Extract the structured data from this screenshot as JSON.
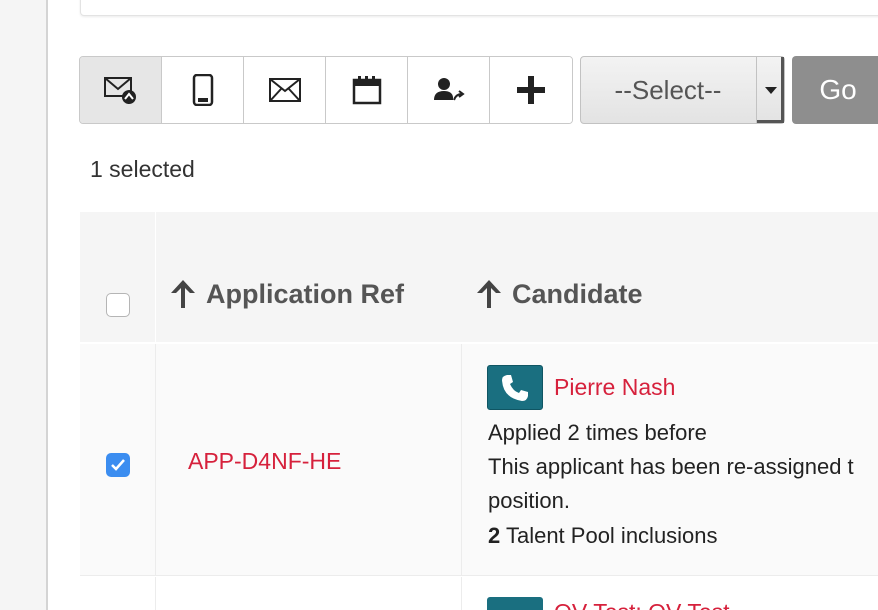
{
  "toolbar": {
    "buttons": [
      {
        "icon": "email-forward-icon"
      },
      {
        "icon": "mobile-phone-icon"
      },
      {
        "icon": "envelope-icon"
      },
      {
        "icon": "calendar-icon"
      },
      {
        "icon": "reassign-user-icon"
      },
      {
        "icon": "plus-icon"
      }
    ],
    "select_value": "--Select--",
    "go_label": "Go"
  },
  "selection": {
    "count_text": "1 selected"
  },
  "table": {
    "columns": [
      "Application Ref",
      "Candidate"
    ],
    "rows": [
      {
        "checked": true,
        "ref": "APP-D4NF-HE",
        "candidate_name": "Pierre Nash",
        "applied_text": "Applied 2 times before",
        "reassigned_text": "This applicant has been re-assigned t",
        "position_text": "position.",
        "talent_pool_count": "2",
        "talent_pool_text": " Talent Pool inclusions"
      },
      {
        "checked": false,
        "ref": "",
        "candidate_name": "QV Test: QV Test"
      }
    ]
  },
  "colors": {
    "link_red": "#d6213c",
    "phone_teal": "#1a6f80",
    "checkbox_blue": "#3b8df0",
    "go_gray": "#8e8e8e"
  }
}
